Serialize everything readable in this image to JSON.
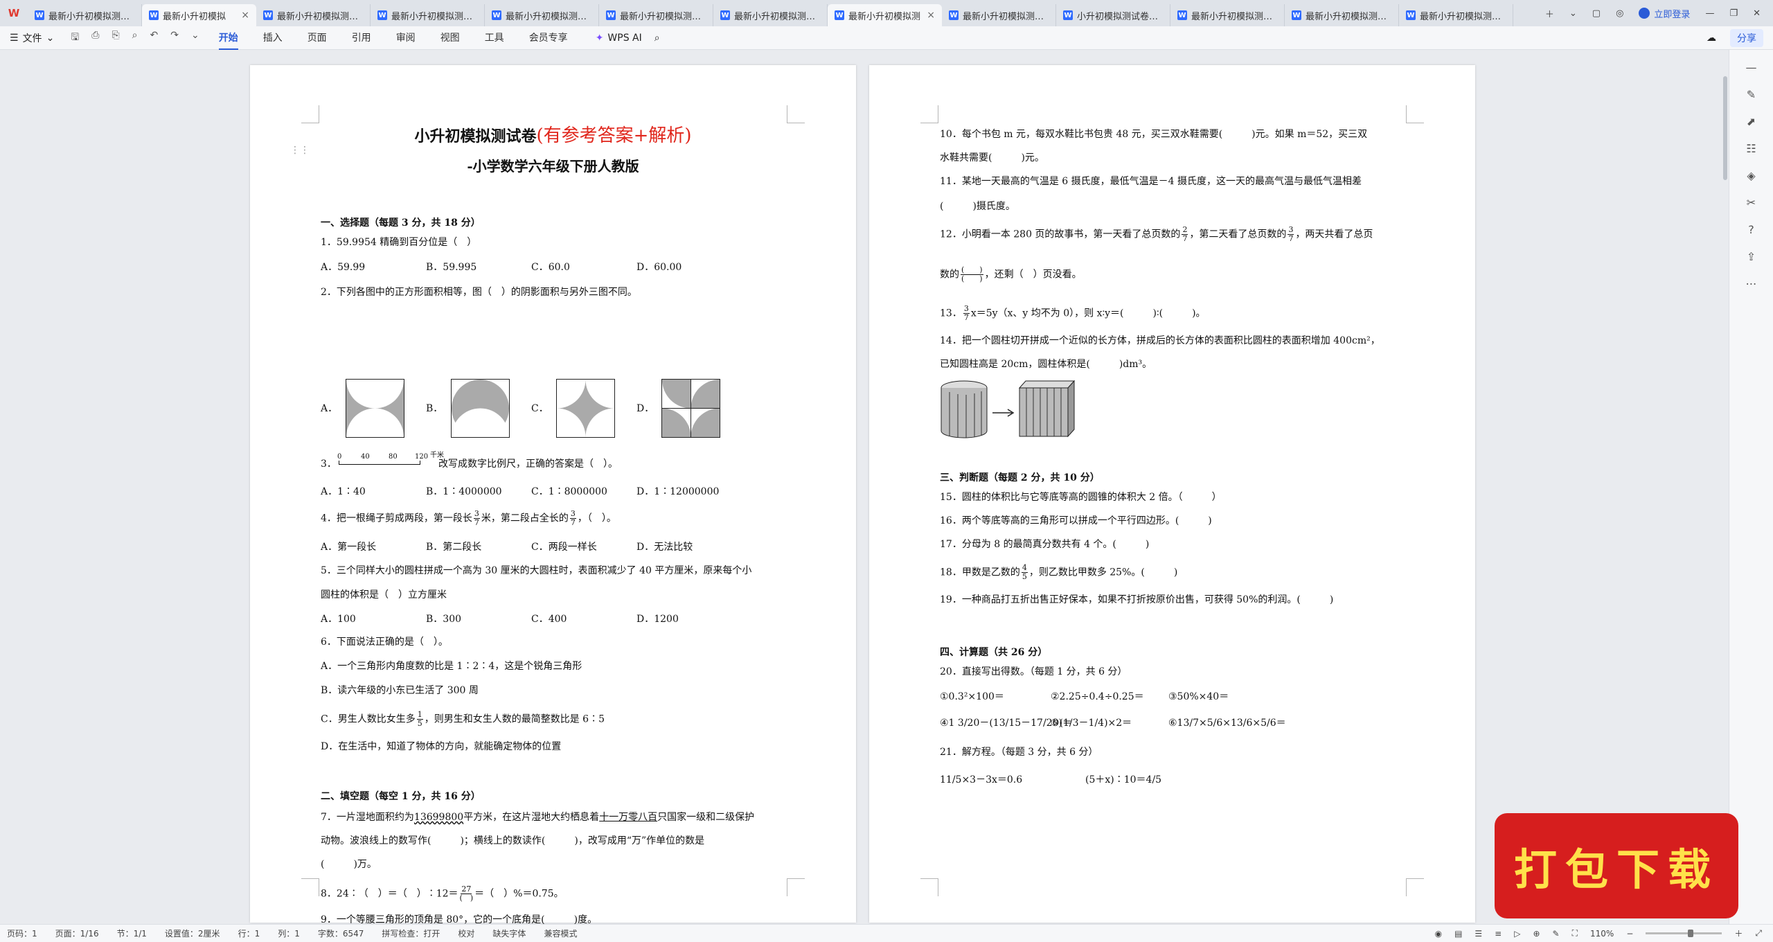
{
  "tabs": [
    "最新小升初模拟测试卷",
    "最新小升初模拟",
    "最新小升初模拟测试卷",
    "最新小升初模拟测试卷",
    "最新小升初模拟测试卷",
    "最新小升初模拟测试卷",
    "最新小升初模拟测试卷",
    "最新小升初模拟测",
    "最新小升初模拟测试卷",
    "小升初模拟测试卷（A",
    "最新小升初模拟测试卷",
    "最新小升初模拟测试卷",
    "最新小升初模拟测试卷"
  ],
  "header": {
    "login": "立即登录",
    "share": "分享"
  },
  "toolbar": {
    "file": "文件",
    "menu": [
      "开始",
      "插入",
      "页面",
      "引用",
      "审阅",
      "视图",
      "工具",
      "会员专享"
    ],
    "wpsai": "WPS AI"
  },
  "page1": {
    "title_main": "小升初模拟测试卷",
    "title_red": "(有参考答案+解析)",
    "subtitle": "-小学数学六年级下册人教版",
    "sec1": "一、选择题（每题 3 分，共 18 分）",
    "q1": "1．59.9954 精确到百分位是（　）",
    "q1_opts": [
      "A．59.99",
      "B．59.995",
      "C．60.0",
      "D．60.00"
    ],
    "q2": "2．下列各图中的正方形面积相等，图（　）的阴影面积与另外三图不同。",
    "q2_labels": [
      "A．",
      "B．",
      "C．",
      "D．"
    ],
    "q3_pre": "3．",
    "q3_scale": [
      "0",
      "40",
      "80",
      "120",
      "千米"
    ],
    "q3_post": "改写成数字比例尺，正确的答案是（　）。",
    "q3_opts": [
      "A．1∶40",
      "B．1∶4000000",
      "C．1∶8000000",
      "D．1∶12000000"
    ],
    "q4": "4．把一根绳子剪成两段，第一段长",
    "q4_b": "米，第二段占全长的",
    "q4_c": "，（　）。",
    "q4_f1": [
      "3",
      "7"
    ],
    "q4_f2": [
      "3",
      "7"
    ],
    "q4_opts": [
      "A．第一段长",
      "B．第二段长",
      "C．两段一样长",
      "D．无法比较"
    ],
    "q5a": "5．三个同样大小的圆柱拼成一个高为 30 厘米的大圆柱时，表面积减少了 40 平方厘米，原来每个小",
    "q5b": "圆柱的体积是（　）立方厘米",
    "q5_opts": [
      "A．100",
      "B．300",
      "C．400",
      "D．1200"
    ],
    "q6": "6．下面说法正确的是（　）。",
    "q6a": "A．一个三角形内角度数的比是 1∶2∶4，这是个锐角三角形",
    "q6b": "B．读六年级的小东已生活了 300 周",
    "q6c": "C．男生人数比女生多",
    "q6c2": "，则男生和女生人数的最简整数比是 6∶5",
    "q6c_f": [
      "1",
      "5"
    ],
    "q6d": "D．在生活中，知道了物体的方向，就能确定物体的位置",
    "sec2": "二、填空题（每空 1 分，共 16 分）",
    "q7a": "7．一片湿地面积约为",
    "q7n": "13699800",
    "q7b": "平方米，在这片湿地大约栖息着",
    "q7n2": "十一万零八百",
    "q7c": "只国家一级和二级保护",
    "q7d": "动物。波浪线上的数写作(　　　)；横线上的数读作(　　　)，改写成用“万”作单位的数是",
    "q7e": "(　　　)万。",
    "q8": "8．24∶（　）＝（　）∶12＝",
    "q8_f": [
      "27",
      "(　)"
    ],
    "q8b": "＝（　）%＝0.75。",
    "q9": "9．一个等腰三角形的顶角是 80°，它的一个底角是(　　　)度。"
  },
  "page2": {
    "q10a": "10．每个书包 m 元，每双水鞋比书包贵 48 元，买三双水鞋需要(　　　)元。如果 m＝52，买三双",
    "q10b": "水鞋共需要(　　　)元。",
    "q11a": "11．某地一天最高的气温是 6 摄氏度，最低气温是－4 摄氏度，这一天的最高气温与最低气温相差",
    "q11b": "(　　　)摄氏度。",
    "q12a": "12．小明看一本 280 页的故事书，第一天看了总页数的",
    "q12_f1": [
      "2",
      "7"
    ],
    "q12b": "，第二天看了总页数的",
    "q12_f2": [
      "3",
      "7"
    ],
    "q12c": "，两天共看了总页",
    "q12d": "数的",
    "q12_f3": [
      "(　　)",
      "(　　)"
    ],
    "q12e": "，还剩（　）页没看。",
    "q13_f": [
      "3",
      "7"
    ],
    "q13": "x＝5y（x、y 均不为 0），则 x∶y＝(　　　)∶(　　　)。",
    "q13_pre": "13．",
    "q14a": "14．把一个圆柱切开拼成一个近似的长方体，拼成后的长方体的表面积比圆柱的表面积增加 400cm²，",
    "q14b": "已知圆柱高是 20cm，圆柱体积是(　　　)dm³。",
    "sec3": "三、判断题（每题 2 分，共 10 分）",
    "q15": "15．圆柱的体积比与它等底等高的圆锥的体积大 2 倍。（　　　）",
    "q16": "16．两个等底等高的三角形可以拼成一个平行四边形。(　　　)",
    "q17": "17．分母为 8 的最简真分数共有 4 个。(　　　)",
    "q18a": "18．甲数是乙数的",
    "q18_f": [
      "4",
      "5"
    ],
    "q18b": "，则乙数比甲数多 25%。(　　　)",
    "q19": "19．一种商品打五折出售正好保本，如果不打折按原价出售，可获得 50%的利润。(　　　)",
    "sec4": "四、计算题（共 26 分）",
    "q20": "20．直接写出得数。（每题 1 分，共 6 分）",
    "calc1": [
      "①0.3²×100＝",
      "②2.25÷0.4÷0.25＝",
      "③50%×40＝"
    ],
    "calc2": [
      "④1 3/20－(13/15－17/20)＝",
      "⑤(1/3－1/4)×2＝",
      "⑥13/7×5/6×13/6×5/6＝"
    ],
    "q21": "21．解方程。（每题 3 分，共 6 分）",
    "eq1": "11/5×3－3x＝0.6",
    "eq2": "(5＋x)∶10＝4/5"
  },
  "statusbar": {
    "items": [
      "页码：1",
      "页面：1/16",
      "节：1/1",
      "设置值：2厘米",
      "行：1",
      "列：1",
      "字数：6547",
      "拼写检查：打开",
      "校对",
      "缺失字体",
      "兼容模式"
    ],
    "zoom": "110%"
  },
  "promo": "打包下载"
}
